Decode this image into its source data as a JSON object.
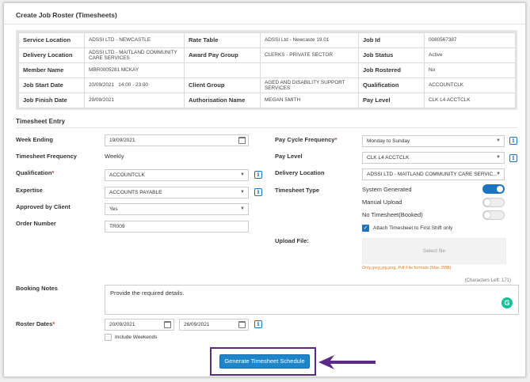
{
  "panel": {
    "title": "Create Job Roster (Timesheets)"
  },
  "info": {
    "service_location": {
      "label": "Service Location",
      "value": "ADSSI LTD - NEWCASTLE"
    },
    "rate_table": {
      "label": "Rate Table",
      "value": "ADSSI Ltd - Newcaste 19.01"
    },
    "job_id": {
      "label": "Job Id",
      "value": "0080567387"
    },
    "delivery_location": {
      "label": "Delivery Location",
      "value": "ADSSI LTD - MAITLAND COMMUNITY CARE SERVICES"
    },
    "award_pay_group": {
      "label": "Award Pay Group",
      "value": "CLERKS - PRIVATE SECTOR"
    },
    "job_status": {
      "label": "Job Status",
      "value": "Active"
    },
    "member_name": {
      "label": "Member Name",
      "value": "MBR0005281 MCKAY"
    },
    "job_rostered": {
      "label": "Job Rostered",
      "value": "No"
    },
    "job_start_date": {
      "label": "Job Start Date",
      "value": "20/09/2021   14:00 - 23:00"
    },
    "client_group": {
      "label": "Client Group",
      "value": "AGED AND DISABILITY SUPPORT SERVICES"
    },
    "qualification": {
      "label": "Qualification",
      "value": "ACCOUNTCLK"
    },
    "job_finish_date": {
      "label": "Job Finish Date",
      "value": "29/09/2021"
    },
    "authorisation_name": {
      "label": "Authorisation Name",
      "value": "MEGAN SMITH"
    },
    "pay_level": {
      "label": "Pay Level",
      "value": "CLK L4 ACCTCLK"
    }
  },
  "timesheet": {
    "section_title": "Timesheet Entry",
    "week_ending": {
      "label": "Week Ending",
      "value": "19/09/2021"
    },
    "timesheet_frequency": {
      "label": "Timesheet Frequency",
      "value": "Weekly"
    },
    "qualification": {
      "label": "Qualification",
      "required": "*",
      "value": "ACCOUNTCLK"
    },
    "expertise": {
      "label": "Expertise",
      "value": "ACCOUNTS PAYABLE"
    },
    "approved_by_client": {
      "label": "Approved by Client",
      "value": "Yes"
    },
    "order_number": {
      "label": "Order Number",
      "value": "TR009"
    },
    "pay_cycle_frequency": {
      "label": "Pay Cycle Frequency",
      "required": "*",
      "value": "Monday to Sunday"
    },
    "pay_level": {
      "label": "Pay Level",
      "value": "CLK L4 ACCTCLK"
    },
    "delivery_location": {
      "label": "Delivery Location",
      "value": "ADSSI LTD - MAITLAND COMMUNITY CARE SERVIC..."
    },
    "timesheet_type": {
      "label": "Timesheet Type",
      "options": [
        {
          "label": "System Generated",
          "on": true
        },
        {
          "label": "Manual Upload",
          "on": false
        },
        {
          "label": "No Timesheet(Booked)",
          "on": false
        }
      ]
    },
    "attach_first_shift": {
      "label": "Attach Timesheet to First Shift only",
      "checked": true
    },
    "upload": {
      "label": "Upload File:",
      "button": "Select file",
      "hint": "Only.jpeg,jpg,png,.Pdf File formats (Max 2MB)"
    },
    "chars_left": "(Characters Left: 171)",
    "booking_notes": {
      "label": "Booking Notes",
      "value": "Provide the required details."
    },
    "roster_dates": {
      "label": "Roster Dates",
      "required": "*",
      "from": "20/09/2021",
      "to": "26/09/2021"
    },
    "include_weekends": {
      "label": "Include Weekends",
      "checked": false
    }
  },
  "actions": {
    "generate": "Generate Timesheet Schedule"
  },
  "icons": {
    "info": "i",
    "grammarly": "G",
    "check": "✓",
    "dropdown": "▼"
  },
  "colors": {
    "primary": "#1e86c8",
    "highlight": "#5b2a86",
    "required": "#c0392b"
  }
}
